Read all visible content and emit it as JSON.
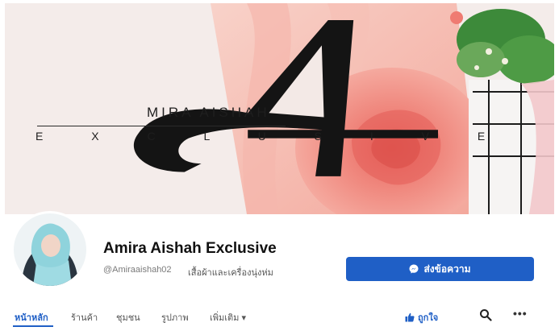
{
  "cover": {
    "brand_name": "MIRA AISHAH",
    "brand_tagline": "E X C L U S I V E"
  },
  "profile": {
    "name": "Amira Aishah Exclusive",
    "handle": "@Amiraaishah02",
    "category": "เสื้อผ้าและเครื่องนุ่งห่ม"
  },
  "actions": {
    "message_label": "ส่งข้อความ",
    "like_label": "ถูกใจ"
  },
  "nav": {
    "items": [
      {
        "label": "หน้าหลัก",
        "active": true
      },
      {
        "label": "ร้านค้า",
        "active": false
      },
      {
        "label": "ชุมชน",
        "active": false
      },
      {
        "label": "รูปภาพ",
        "active": false
      },
      {
        "label": "เพิ่มเติม ▾",
        "active": false
      }
    ],
    "more_label": "•••"
  },
  "colors": {
    "accent": "#1f5fc6",
    "cover_rose": "#f19a91"
  },
  "icons": [
    "messenger-icon",
    "thumbs-up-icon",
    "search-icon",
    "more-icon"
  ]
}
